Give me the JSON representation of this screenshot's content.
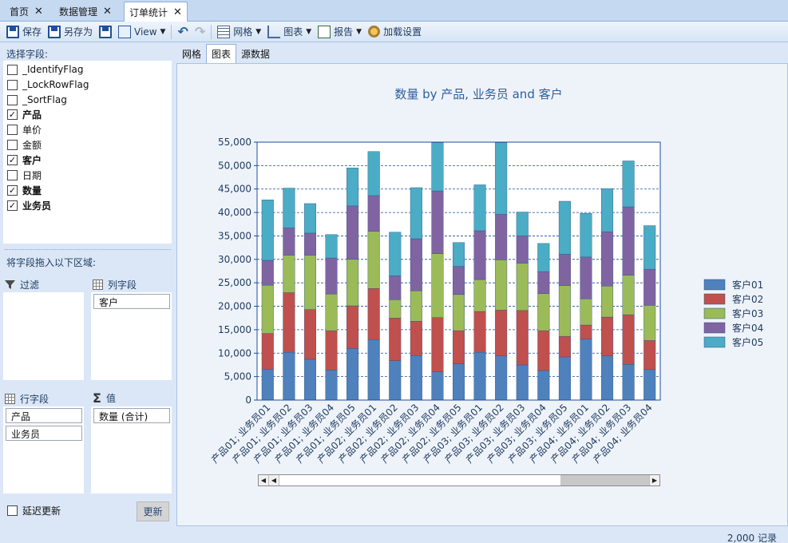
{
  "tabs": [
    {
      "label": "首页",
      "active": false
    },
    {
      "label": "数据管理",
      "active": false
    },
    {
      "label": "订单统计",
      "active": true
    }
  ],
  "toolbar": {
    "save": "保存",
    "save_as": "另存为",
    "view": "View",
    "grid": "网格",
    "chart": "图表",
    "report": "报告",
    "load_settings": "加载设置"
  },
  "left": {
    "select_fields_label": "选择字段:",
    "fields": [
      {
        "label": "_IdentifyFlag",
        "checked": false
      },
      {
        "label": "_LockRowFlag",
        "checked": false
      },
      {
        "label": "_SortFlag",
        "checked": false
      },
      {
        "label": "产品",
        "checked": true
      },
      {
        "label": "单价",
        "checked": false
      },
      {
        "label": "金额",
        "checked": false
      },
      {
        "label": "客户",
        "checked": true
      },
      {
        "label": "日期",
        "checked": false
      },
      {
        "label": "数量",
        "checked": true
      },
      {
        "label": "业务员",
        "checked": true
      }
    ],
    "drag_hint": "将字段拖入以下区域:",
    "filter_label": "过滤",
    "column_label": "列字段",
    "column_fields": [
      "客户"
    ],
    "row_label": "行字段",
    "row_fields": [
      "产品",
      "业务员"
    ],
    "value_label": "值",
    "value_fields": [
      "数量 (合计)"
    ],
    "defer_update": "延迟更新",
    "refresh_button": "更新"
  },
  "view_tabs": [
    {
      "label": "网格",
      "active": false
    },
    {
      "label": "图表",
      "active": true
    },
    {
      "label": "源数据",
      "active": false
    }
  ],
  "status": "2,000 记录",
  "chart_data": {
    "type": "bar",
    "stacked": true,
    "title": "数量 by 产品, 业务员 and 客户",
    "ylim": [
      0,
      55000
    ],
    "yticks": [
      "0",
      "5,000",
      "10,000",
      "15,000",
      "20,000",
      "25,000",
      "30,000",
      "35,000",
      "40,000",
      "45,000",
      "50,000",
      "55,000"
    ],
    "grid": true,
    "legend_position": "right",
    "categories": [
      "产品01; 业务员01",
      "产品01; 业务员02",
      "产品01; 业务员03",
      "产品01; 业务员04",
      "产品01; 业务员05",
      "产品02; 业务员01",
      "产品02; 业务员02",
      "产品02; 业务员03",
      "产品02; 业务员04",
      "产品02; 业务员05",
      "产品03; 业务员01",
      "产品03; 业务员02",
      "产品03; 业务员03",
      "产品03; 业务员04",
      "产品03; 业务员05",
      "产品04; 业务员01",
      "产品04; 业务员02",
      "产品04; 业务员03",
      "产品04; 业务员04"
    ],
    "series": [
      {
        "name": "客户01",
        "color": "#4f81bd",
        "values": [
          6600,
          10200,
          8700,
          6400,
          11000,
          12900,
          8400,
          9500,
          6000,
          7700,
          10200,
          9400,
          7500,
          6300,
          9200,
          13000,
          9400,
          7600,
          6500
        ]
      },
      {
        "name": "客户02",
        "color": "#c0504d",
        "values": [
          7600,
          12700,
          10600,
          8400,
          9100,
          10900,
          9100,
          7300,
          11600,
          7100,
          8700,
          9800,
          11600,
          8500,
          4400,
          3000,
          8300,
          10600,
          6200
        ]
      },
      {
        "name": "客户03",
        "color": "#9bbb59",
        "values": [
          10300,
          8000,
          11600,
          7800,
          9900,
          12200,
          3900,
          6500,
          13600,
          7700,
          6800,
          10700,
          10100,
          7900,
          10800,
          5600,
          6600,
          8400,
          7500
        ]
      },
      {
        "name": "客户04",
        "color": "#8064a2",
        "values": [
          5300,
          5800,
          4700,
          7700,
          11400,
          7600,
          5100,
          11100,
          13400,
          6000,
          10400,
          9700,
          5800,
          4700,
          6700,
          8900,
          11600,
          14600,
          7700
        ]
      },
      {
        "name": "客户05",
        "color": "#4bacc6",
        "values": [
          12900,
          8500,
          6300,
          5000,
          8100,
          9400,
          9300,
          10900,
          10300,
          5100,
          9800,
          15300,
          5100,
          6000,
          11300,
          9300,
          9200,
          9800,
          9300
        ]
      }
    ]
  }
}
